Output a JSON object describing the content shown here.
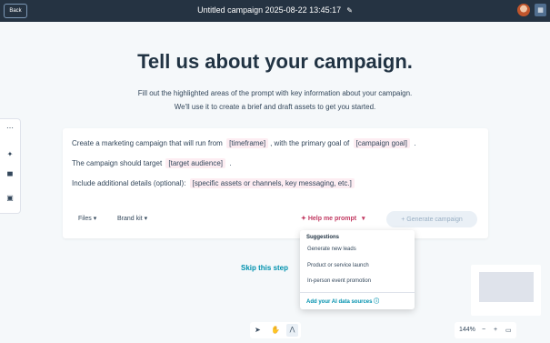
{
  "topbar": {
    "back_label": "Back",
    "title": "Untitled campaign 2025-08-22 13:45:17",
    "edit_icon": "pencil-icon",
    "avatar_icon": "user-avatar",
    "apps_icon": "apps-icon"
  },
  "left_tools": [
    "grip-icon",
    "sparkle-icon",
    "comment-icon",
    "calendar-icon"
  ],
  "headline": "Tell us about your campaign.",
  "subtitle": [
    "Fill out the highlighted areas of the prompt with key information about your campaign.",
    "We'll use it to create a brief and draft assets to get you started."
  ],
  "prompt": {
    "line1_prefix": "Create a marketing campaign that will run from",
    "timeframe": "[timeframe]",
    "line1_middle": ", with the primary goal of",
    "goal": "[campaign goal]",
    "line1_suffix": ".",
    "line2_prefix": "The campaign should target",
    "audience": "[target audience]",
    "line2_suffix": ".",
    "line3_prefix": "Include additional details (optional):",
    "details": "[specific assets or channels, key messaging, etc.]"
  },
  "card_actions": {
    "files_label": "Files",
    "brand_kit_label": "Brand kit",
    "help_label": "Help me prompt",
    "generate_label": "Generate campaign",
    "colors": {
      "help": "#c23a62",
      "generate_disabled": "#eaf0f6"
    }
  },
  "suggestions": {
    "title": "Suggestions",
    "items": [
      "Generate new leads",
      "Product or service launch",
      "In-person event promotion"
    ],
    "link_label": "Add your AI data sources",
    "link_icon": "info-icon"
  },
  "skip_label": "Skip this step",
  "bottom_tools": [
    "pointer-icon",
    "hand-icon",
    "branch-icon"
  ],
  "zoom": {
    "level": "144%",
    "minus": "−",
    "plus": "+",
    "fit_icon": "fit-screen-icon"
  },
  "colors": {
    "accent": "#0091ae",
    "topbar": "#253342",
    "chip": "#fdedf2"
  }
}
